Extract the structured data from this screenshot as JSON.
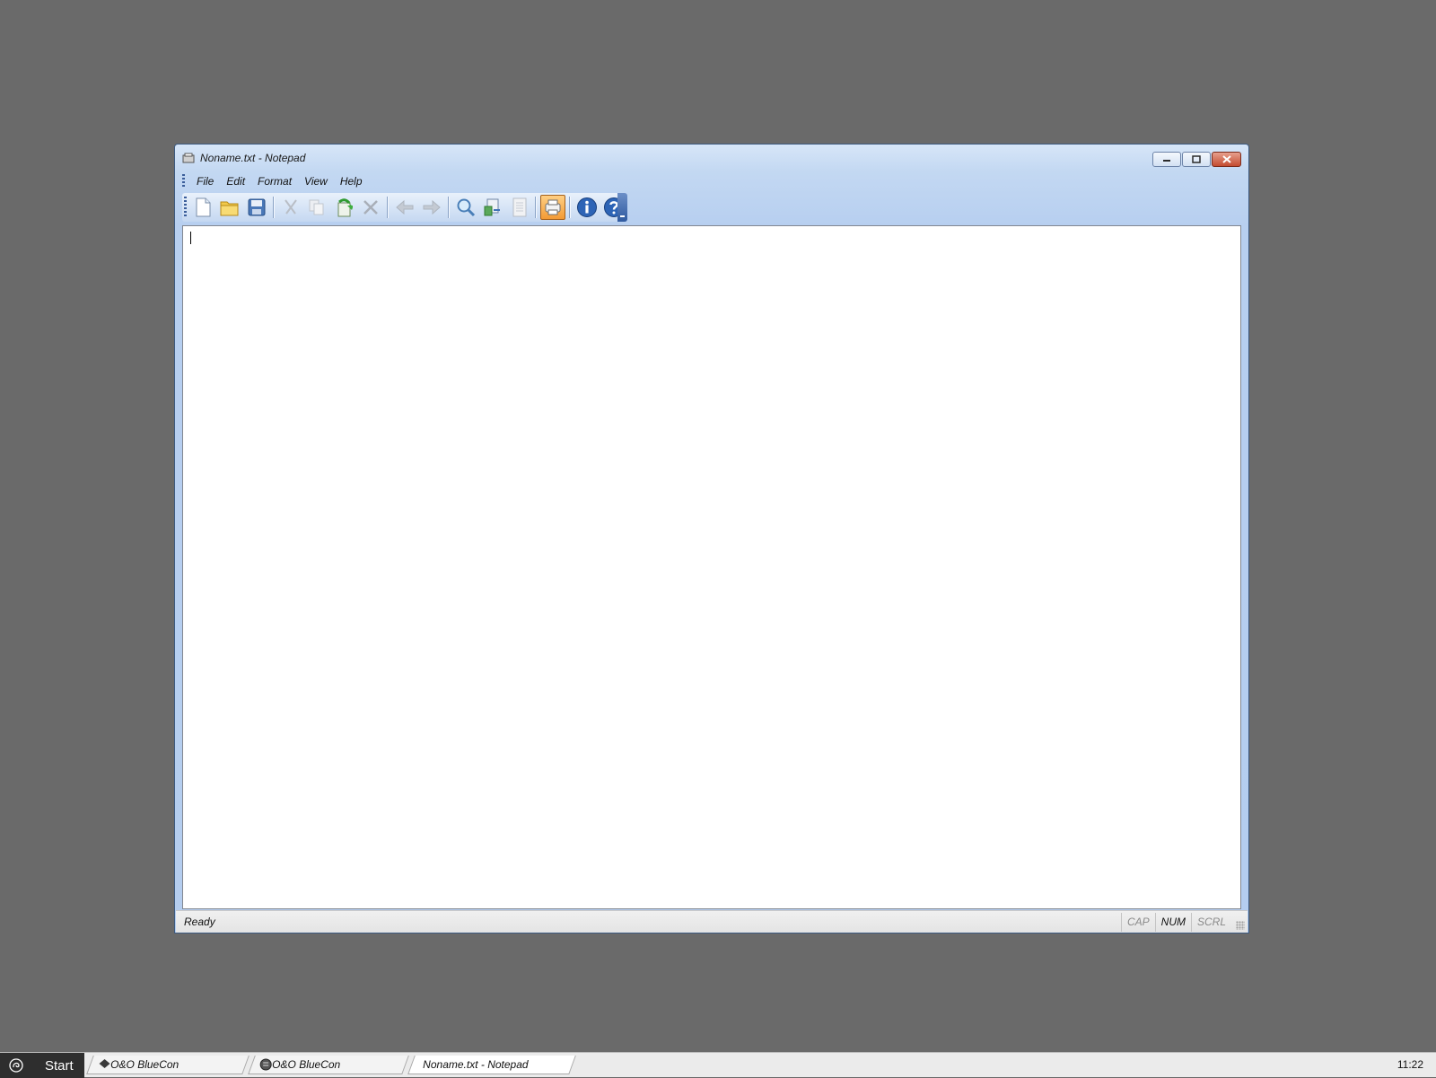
{
  "window": {
    "title": "Noname.txt - Notepad",
    "controls": {
      "minimize": "minimize",
      "maximize": "maximize",
      "close": "close"
    }
  },
  "menu": [
    "File",
    "Edit",
    "Format",
    "View",
    "Help"
  ],
  "toolbar": {
    "buttons": [
      {
        "icon": "new-file-icon"
      },
      {
        "icon": "open-folder-icon"
      },
      {
        "icon": "save-disk-icon"
      },
      {
        "icon": "cut-scissors-icon",
        "enabled": false
      },
      {
        "icon": "copy-icon",
        "enabled": false
      },
      {
        "icon": "paste-icon"
      },
      {
        "icon": "delete-x-icon",
        "enabled": false
      },
      {
        "icon": "undo-arrow-icon",
        "enabled": false
      },
      {
        "icon": "redo-arrow-icon",
        "enabled": false
      },
      {
        "icon": "find-magnifier-icon"
      },
      {
        "icon": "replace-icon"
      },
      {
        "icon": "page-setup-icon",
        "enabled": false
      },
      {
        "icon": "print-icon",
        "active": true
      },
      {
        "icon": "info-icon"
      },
      {
        "icon": "help-question-icon"
      }
    ]
  },
  "editor": {
    "text": ""
  },
  "status": {
    "text": "Ready",
    "indicators": [
      "CAP",
      "NUM",
      "SCRL"
    ],
    "active_indicator": "NUM"
  },
  "taskbar": {
    "start": "Start",
    "tasks": [
      "O&O BlueCon",
      "O&O BlueCon",
      "Noname.txt - Notepad"
    ],
    "clock": "11:22"
  },
  "colors": {
    "desktop": "#6a6a6a",
    "start_bg": "#2e2e2e",
    "active_button": "#f39a34"
  }
}
